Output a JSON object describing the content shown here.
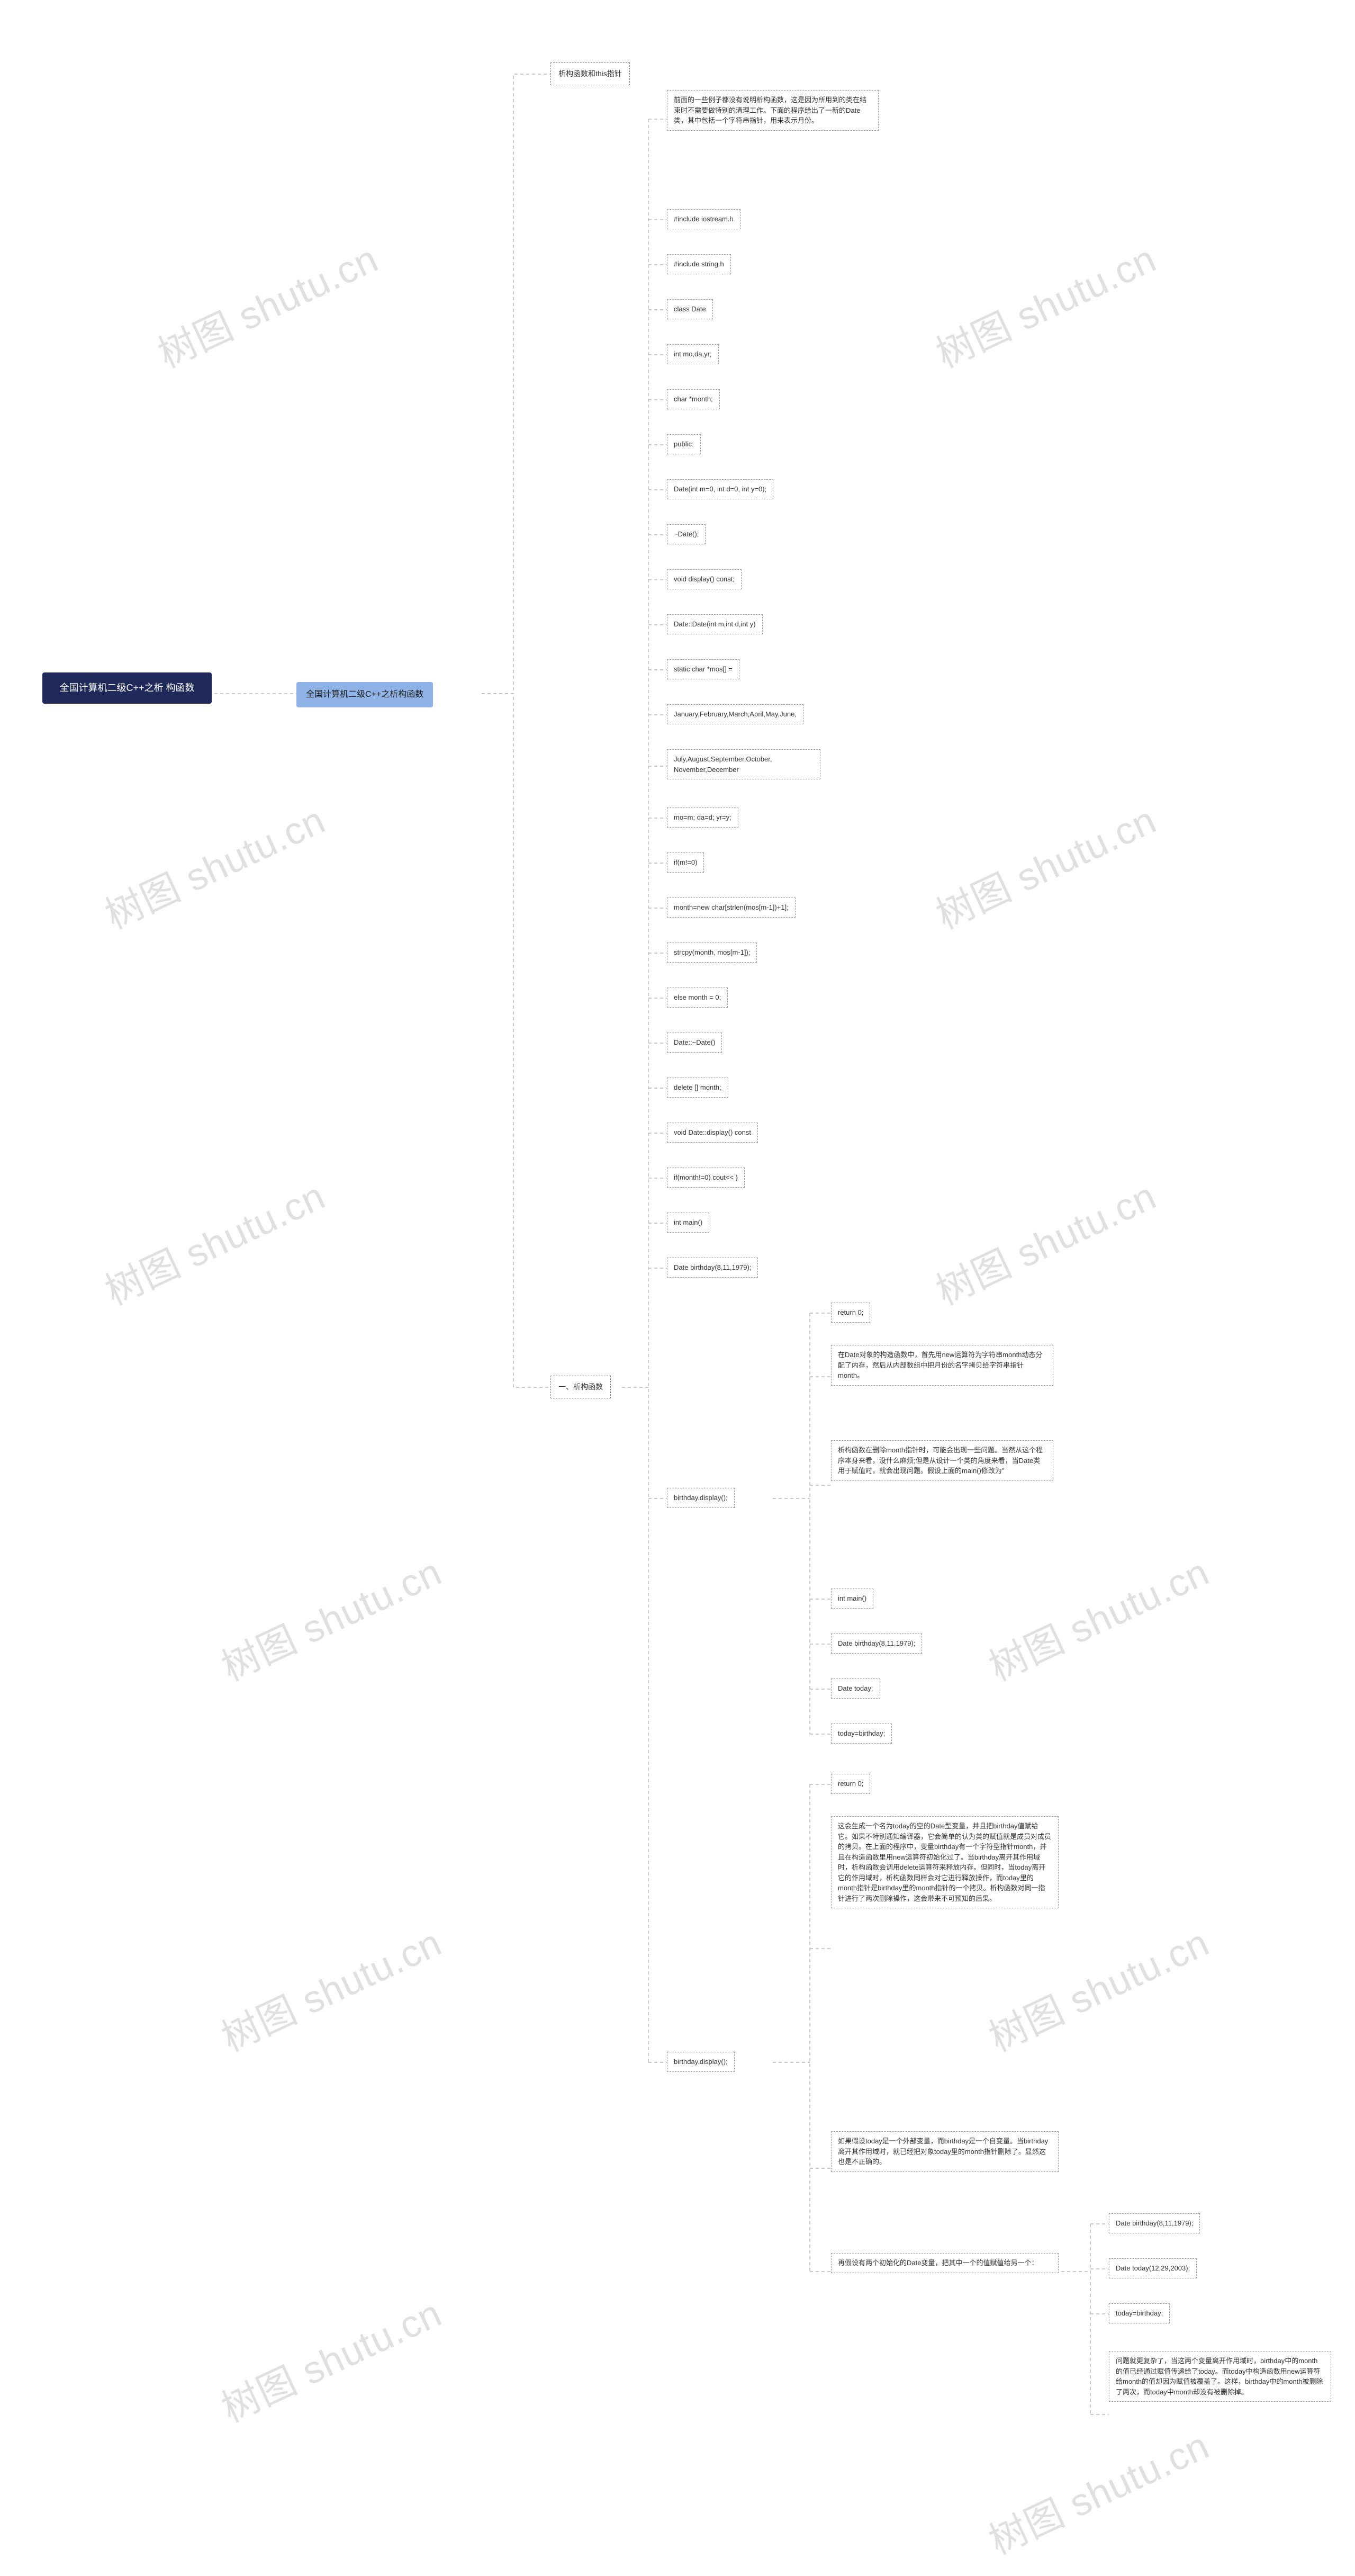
{
  "watermark": "树图 shutu.cn",
  "root": {
    "label": "全国计算机二级C++之析\n构函数"
  },
  "sub": {
    "label": "全国计算机二级C++之析构函数"
  },
  "sections": {
    "a": "析构函数和this指针",
    "b": "一、析构函数"
  },
  "leaves_b": [
    "前面的一些例子都没有说明析构函数，这是因为所用到的类在结束时不需要做特别的清理工作。下面的程序给出了一新的Date类，其中包括一个字符串指针，用来表示月份。",
    "#include iostream.h",
    "#include string.h",
    "class Date",
    "int mo,da,yr;",
    "char *month;",
    "public:",
    "Date(int m=0, int d=0, int y=0);",
    "~Date();",
    "void display() const;",
    "Date::Date(int m,int d,int y)",
    "static char *mos[] =",
    "January,February,March,April,May,June,",
    "July,August,September,October,\nNovember,December",
    "mo=m; da=d; yr=y;",
    "if(m!=0)",
    "month=new char[strlen(mos[m-1])+1];",
    "strcpy(month, mos[m-1]);",
    "else month = 0;",
    "Date::~Date()",
    "delete [] month;",
    "void Date::display() const",
    "if(month!=0) cout<< }",
    "int main()",
    "Date birthday(8,11,1979);",
    "birthday.display();",
    "birthday.display();"
  ],
  "leaves_bd1": [
    "return 0;",
    "在Date对象的构造函数中，首先用new运算符为字符串month动态分配了内存，然后从内部数组中把月份的名字拷贝给字符串指针month。",
    "析构函数在删除month指针时，可能会出现一些问题。当然从这个程序本身来看，没什么麻烦;但是从设计一个类的角度来看，当Date类用于赋值时，就会出现问题。假设上面的main()修改为\"",
    "int main()",
    "Date birthday(8,11,1979);",
    "Date today;",
    "today=birthday;"
  ],
  "leaves_bd2": [
    "return 0;",
    "这会生成一个名为today的空的Date型变量，并且把birthday值赋给它。如果不特别通知编译器，它会简单的认为类的赋值就是成员对成员的拷贝。在上面的程序中，变量birthday有一个字符型指针month，并且在构造函数里用new运算符初始化过了。当birthday离开其作用域时，析构函数会调用delete运算符来释放内存。但同时，当today离开它的作用域时，析构函数同样会对它进行释放操作，而today里的month指针是birthday里的month指针的一个拷贝。析构函数对同一指针进行了两次删除操作，这会带来不可预知的后果。",
    "如果假设today是一个外部变量，而birthday是一个自变量。当birthday离开其作用域时，就已经把对象today里的month指针删除了。显然这也是不正确的。",
    "再假设有两个初始化的Date变量，把其中一个的值赋值给另一个："
  ],
  "leaves_deep": [
    "Date birthday(8,11,1979);",
    "Date today(12,29,2003);",
    "today=birthday;",
    "问题就更复杂了，当这两个变量离开作用域时，birthday中的month的值已经通过赋值传递给了today。而today中构造函数用new运算符给month的值却因为赋值被覆盖了。这样，birthday中的month被删除了两次，而today中month却没有被删除掉。"
  ]
}
